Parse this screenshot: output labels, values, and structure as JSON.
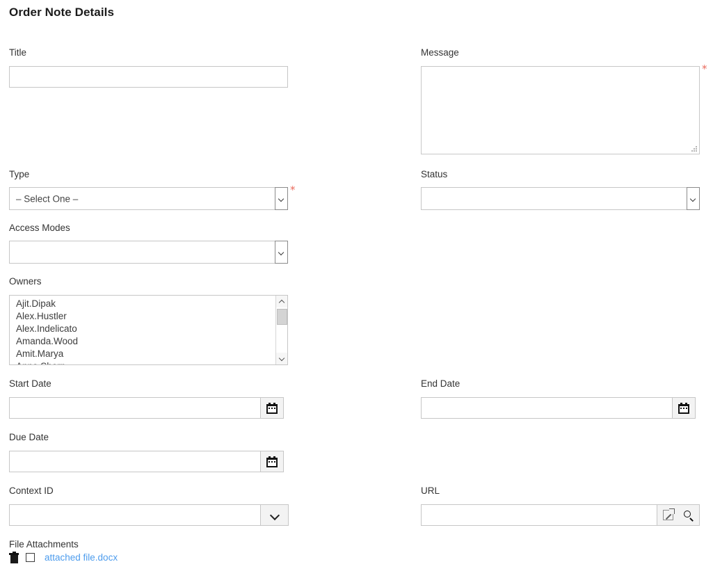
{
  "page": {
    "title": "Order Note Details"
  },
  "fields": {
    "title": {
      "label": "Title",
      "value": "",
      "placeholder": ""
    },
    "message": {
      "label": "Message",
      "value": "",
      "placeholder": "",
      "required_marker": "*"
    },
    "type": {
      "label": "Type",
      "selected": "– Select One –",
      "required_marker": "*"
    },
    "status": {
      "label": "Status",
      "selected": ""
    },
    "access_modes": {
      "label": "Access Modes",
      "selected": ""
    },
    "owners": {
      "label": "Owners",
      "options": [
        "Ajit.Dipak",
        "Alex.Hustler",
        "Alex.Indelicato",
        "Amanda.Wood",
        "Amit.Marya",
        "Anna.Sharp"
      ]
    },
    "start_date": {
      "label": "Start Date",
      "value": "",
      "placeholder": ""
    },
    "end_date": {
      "label": "End Date",
      "value": "",
      "placeholder": ""
    },
    "due_date": {
      "label": "Due Date",
      "value": "",
      "placeholder": ""
    },
    "context_id": {
      "label": "Context ID",
      "value": "",
      "placeholder": ""
    },
    "url": {
      "label": "URL",
      "value": "",
      "placeholder": ""
    },
    "file_attachments": {
      "label": "File Attachments",
      "items": [
        {
          "name": "attached file.docx"
        }
      ]
    }
  },
  "icons": {
    "calendar": "calendar-icon",
    "chevron_down": "chevron-down-icon",
    "external_link": "external-link-icon",
    "search": "search-icon",
    "trash": "trash-icon"
  },
  "colors": {
    "link": "#4d9ced",
    "required": "#ea6b5e",
    "border": "#c6c6c6",
    "text": "#333333"
  }
}
